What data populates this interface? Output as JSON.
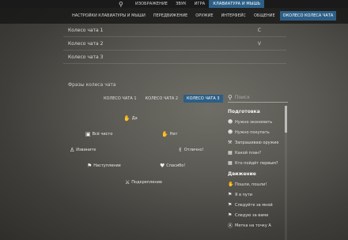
{
  "topbar": {
    "tabs": [
      "ИЗОБРАЖЕНИЕ",
      "ЗВУК",
      "ИГРА",
      "КЛАВИАТУРА И МЫШЬ"
    ],
    "active_index": 3
  },
  "subbar": {
    "tabs": [
      "НАСТРОЙКИ КЛАВИАТУРЫ И МЫШИ",
      "ПЕРЕДВИЖЕНИЕ",
      "ОРУЖИЕ",
      "ИНТЕРФЕЙС",
      "ОБЩЕНИЕ",
      "ОКОЛЕСО КОЛЕСА ЧАТА"
    ],
    "active_index": 5
  },
  "rows": [
    {
      "label": "Колесо чата 1",
      "key": "C"
    },
    {
      "label": "Колесо чата 2",
      "key": "V"
    },
    {
      "label": "Колесо чата 3",
      "key": ""
    }
  ],
  "phrases_title": "Фразы колеса чата",
  "wheel_tabs": [
    "КОЛЕСО ЧАТА 1",
    "КОЛЕСО ЧАТА 2",
    "КОЛЕСО ЧАТА 3"
  ],
  "wheel_active": 2,
  "wheel": {
    "top": "Да",
    "top_left": "Всё чисто",
    "top_right": "Нет",
    "left": "Извините",
    "right": "Отлично!",
    "bottom_left": "Наступление",
    "bottom_right": "Спасибо!",
    "bottom": "Подкрепление"
  },
  "search": {
    "placeholder": "Поиск"
  },
  "panel": {
    "section1": "Подготовка",
    "items1": [
      "Нужно экономить",
      "Нужно покупать",
      "Запрашиваю оружие",
      "Какой план?",
      "Кто пойдёт первым?"
    ],
    "section2": "Движение",
    "items2": [
      "Пошли, пошли!",
      "Я в пути",
      "Следуйте за мной",
      "Следую за вами",
      "Метка на точку А"
    ]
  }
}
